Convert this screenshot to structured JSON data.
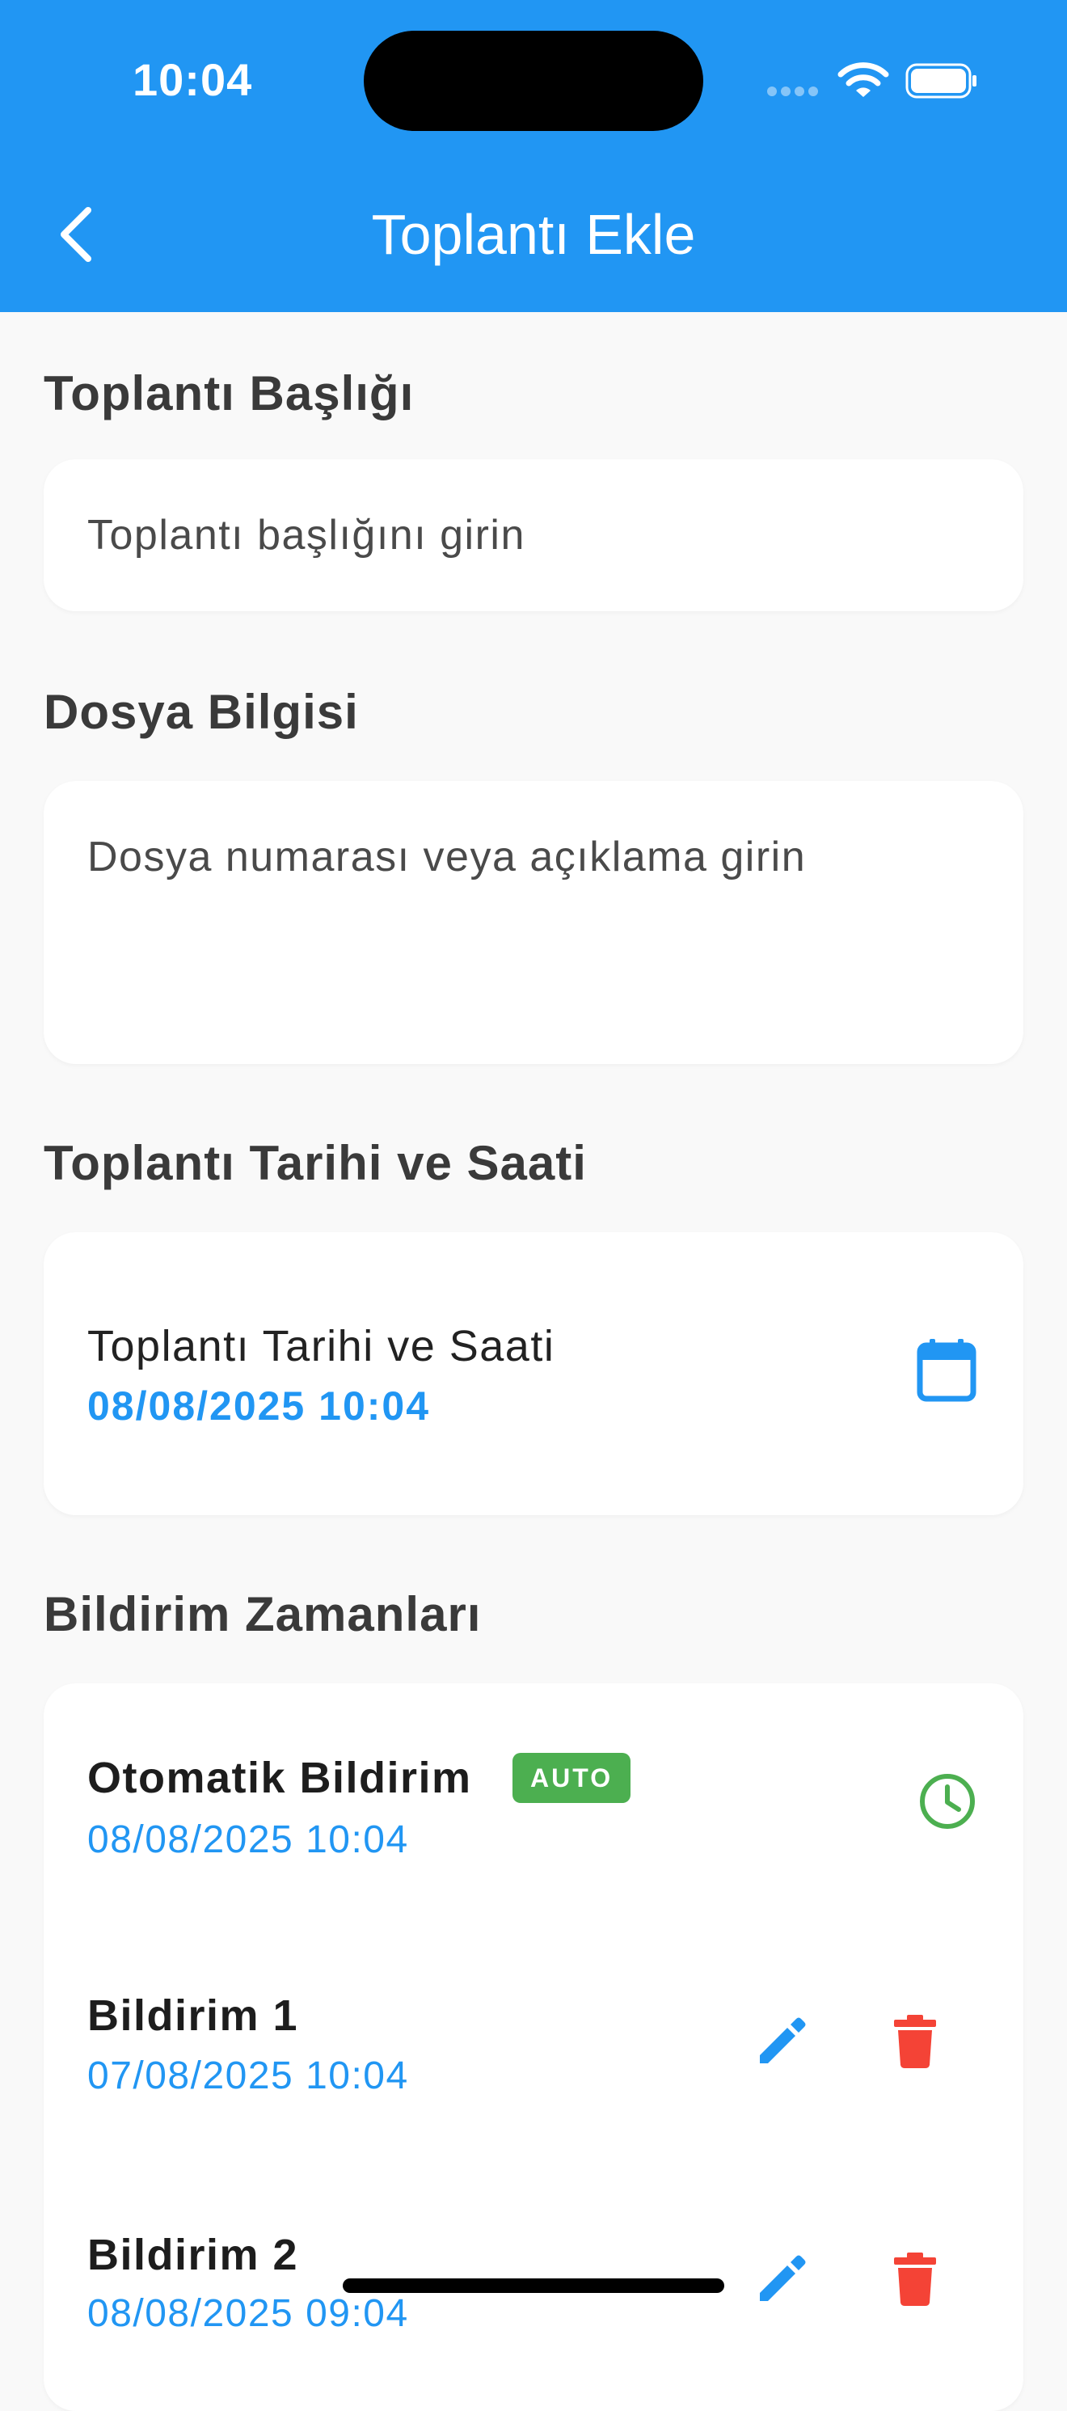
{
  "status_bar": {
    "time": "10:04"
  },
  "app_bar": {
    "title": "Toplantı Ekle"
  },
  "sections": {
    "title_label": "Toplantı Başlığı",
    "title_placeholder": "Toplantı başlığını girin",
    "file_label": "Dosya Bilgisi",
    "file_placeholder": "Dosya numarası veya açıklama girin",
    "datetime_label": "Toplantı Tarihi ve Saati",
    "datetime_card_label": "Toplantı Tarihi ve Saati",
    "datetime_value": "08/08/2025 10:04",
    "notifications_label": "Bildirim Zamanları"
  },
  "notifications": [
    {
      "title": "Otomatik Bildirim",
      "badge": "AUTO",
      "date": "08/08/2025 10:04"
    },
    {
      "title": "Bildirim 1",
      "date": "07/08/2025 10:04"
    },
    {
      "title": "Bildirim 2",
      "date": "08/08/2025 09:04"
    }
  ],
  "colors": {
    "primary": "#2196f3",
    "auto_badge": "#4caf50",
    "delete": "#f44336",
    "background": "#f9f9f9"
  },
  "icons": {
    "back": "chevron-left-icon",
    "calendar": "calendar-icon",
    "clock": "clock-icon",
    "edit": "pencil-icon",
    "delete": "trash-icon"
  }
}
